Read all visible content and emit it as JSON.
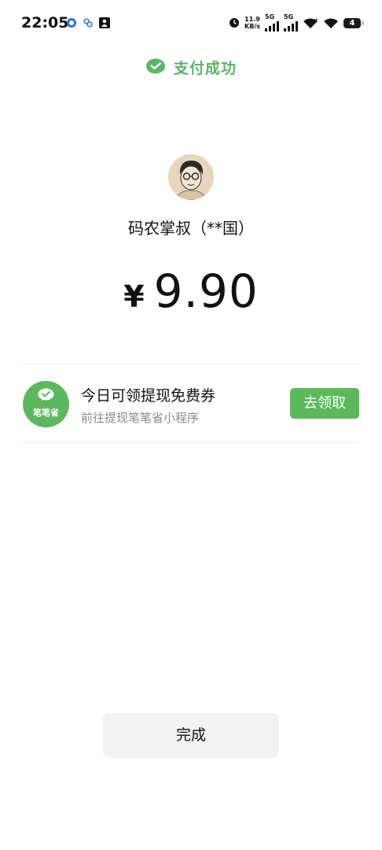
{
  "status_bar": {
    "time": "22:05",
    "net_speed_value": "11.9",
    "net_speed_unit": "KB/s",
    "sim1_label": "5G",
    "sim2_label": "5G",
    "battery": "4"
  },
  "header": {
    "title": "支付成功",
    "icon": "wechat-pay-check-icon",
    "accent": "#5AB567"
  },
  "payee": {
    "name": "码农掌叔（**国）",
    "avatar": "avatar"
  },
  "payment": {
    "currency": "¥",
    "amount": "9.90"
  },
  "promo": {
    "logo_text": "笔笔省",
    "title": "今日可领提现免费券",
    "subtitle": "前往提现笔笔省小程序",
    "button_label": "去领取",
    "button_color": "#5CB85C"
  },
  "footer": {
    "done_label": "完成"
  }
}
